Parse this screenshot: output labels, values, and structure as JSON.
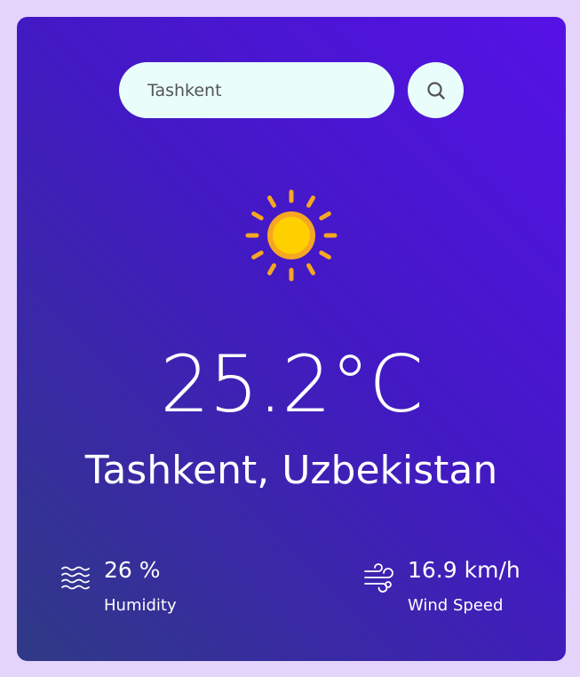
{
  "search": {
    "value": "Tashkent",
    "button_icon": "search-icon"
  },
  "weather": {
    "condition_icon": "sun-icon",
    "temperature": "25.2°C",
    "location": "Tashkent, Uzbekistan"
  },
  "details": {
    "humidity": {
      "icon": "humidity-icon",
      "value": "26 %",
      "label": "Humidity"
    },
    "wind": {
      "icon": "wind-icon",
      "value": "16.9 km/h",
      "label": "Wind Speed"
    }
  },
  "colors": {
    "page_background": "#e4d4fb",
    "card_gradient_start": "#5512e6",
    "card_gradient_end": "#2f3a85",
    "input_background": "#e9fdfb",
    "sun_core": "#ffd000",
    "sun_rays": "#f5a623"
  }
}
